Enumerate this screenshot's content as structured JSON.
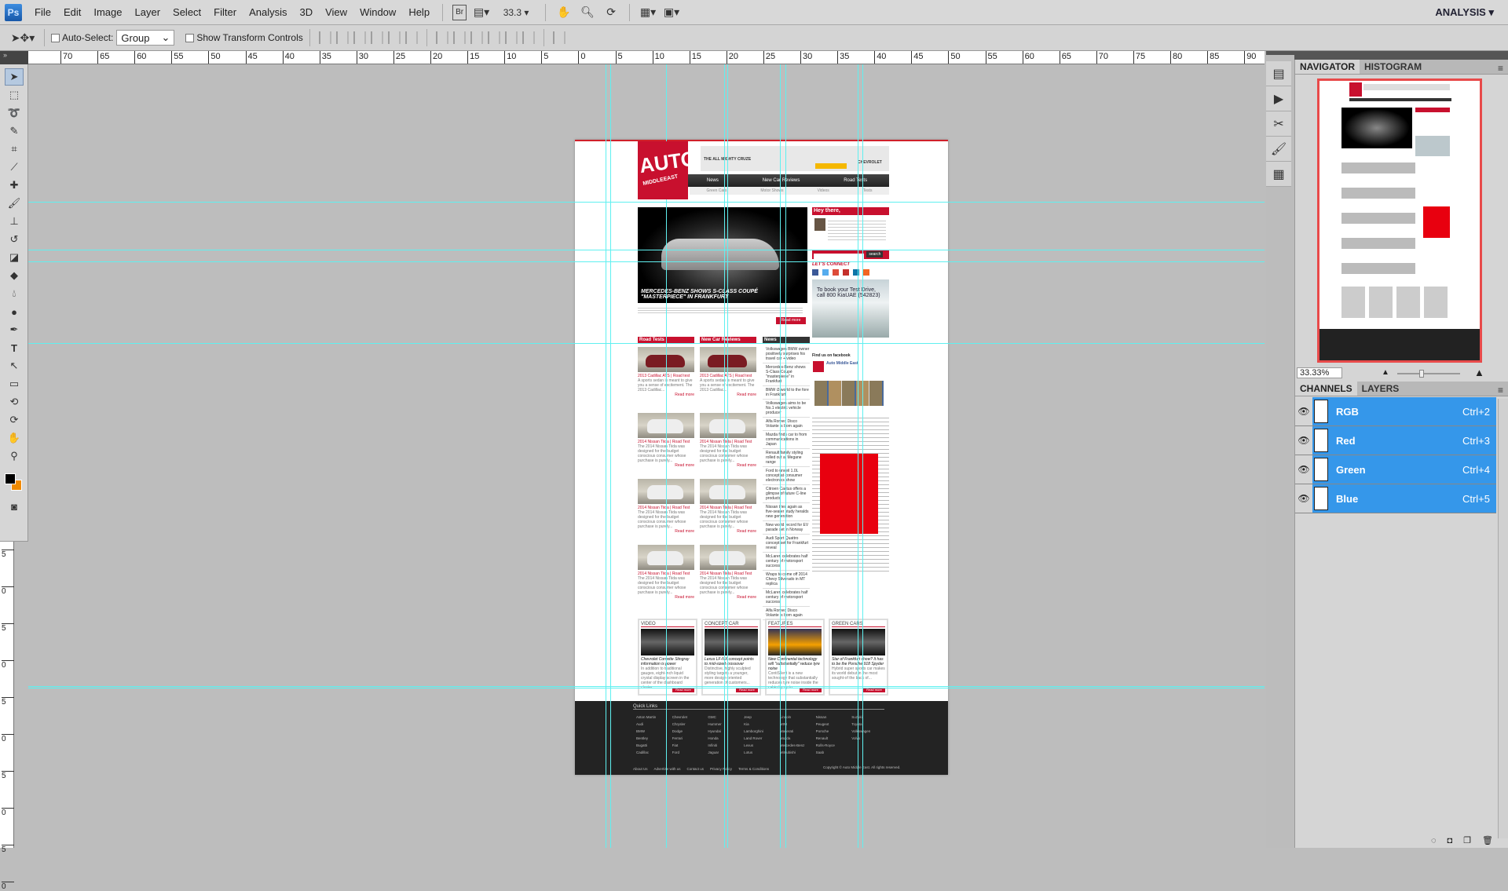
{
  "app": {
    "logo": "Ps",
    "menu": [
      "File",
      "Edit",
      "Image",
      "Layer",
      "Select",
      "Filter",
      "Analysis",
      "3D",
      "View",
      "Window",
      "Help"
    ],
    "zoom_dropdown": "33.3",
    "workspace": "ANALYSIS",
    "toolbar_icons": [
      "bridge-icon",
      "mini-bridge-icon",
      "hand-icon",
      "zoom-icon",
      "rotate-view-icon",
      "arrange-icon",
      "screen-mode-icon"
    ]
  },
  "options": {
    "auto_select_label": "Auto-Select:",
    "auto_select_checked": false,
    "auto_select_value": "Group",
    "show_transform_label": "Show Transform Controls",
    "show_transform_checked": false
  },
  "ruler": {
    "top_labels": [
      "70",
      "65",
      "60",
      "55",
      "50",
      "45",
      "40",
      "35",
      "30",
      "25",
      "20",
      "15",
      "10",
      "5",
      "0",
      "5",
      "10",
      "15",
      "20",
      "25",
      "30",
      "35",
      "40",
      "45",
      "50",
      "55",
      "60",
      "65",
      "70",
      "75",
      "80",
      "85",
      "90"
    ],
    "left_labels": [
      "5",
      "0",
      "5",
      "0",
      "5",
      "0",
      "5",
      "0",
      "5",
      "0"
    ]
  },
  "colors": {
    "guide": "#5ff0f0",
    "brand_red": "#c8102e",
    "channel_selected": "#3597ea",
    "foreground": "#000000",
    "background": "#f08a00"
  },
  "navigator": {
    "tabs": [
      "NAVIGATOR",
      "HISTOGRAM"
    ],
    "zoom_value": "33.33%"
  },
  "channels": {
    "tabs": [
      "CHANNELS",
      "LAYERS"
    ],
    "rows": [
      {
        "name": "RGB",
        "shortcut": "Ctrl+2"
      },
      {
        "name": "Red",
        "shortcut": "Ctrl+3"
      },
      {
        "name": "Green",
        "shortcut": "Ctrl+4"
      },
      {
        "name": "Blue",
        "shortcut": "Ctrl+5"
      }
    ]
  },
  "site": {
    "logo_top": "AUTO",
    "logo_bottom": "MIDDLEEAST",
    "ad_headline": "THE ALL MIGHTY CRUZE",
    "ad_brand": "CHEVROLET",
    "nav": [
      "News",
      "New Car Reviews",
      "Road Tests"
    ],
    "subnav": [
      "Green Cars",
      "Motor Shows",
      "Videos",
      "Tests"
    ],
    "hero_title": "MERCEDES-BENZ SHOWS S-CLASS COUPÉ \"MASTERPIECE\" IN FRANKFURT",
    "hero_button": "Read more",
    "hey_title": "Hey there,",
    "search_button": "search",
    "connect_title": "LET'S CONNECT",
    "kia_ad": "To book your Test Drive, call 800 KiaUAE (542823)",
    "fb_title": "Find us on facebook",
    "fb_page": "Auto Middle East",
    "sections": [
      "Road Tests",
      "New Car Reviews",
      "News"
    ],
    "road_tests": [
      {
        "title": "2013 Cadillac ATS | Road test",
        "text": "A sports sedan is meant to give you a sense of excitement. The 2013 Cadillac..."
      },
      {
        "title": "2014 Nissan Tiida | Road Test",
        "text": "The 2014 Nissan Tiida was designed for the budget conscious consumer whose purchase is purely..."
      },
      {
        "title": "2014 Nissan Tiida | Road Test",
        "text": "The 2014 Nissan Tiida was designed for the budget conscious consumer whose purchase is purely..."
      },
      {
        "title": "2014 Nissan Tiida | Road Test",
        "text": "The 2014 Nissan Tiida was designed for the budget conscious consumer whose purchase is purely..."
      }
    ],
    "reviews": [
      {
        "title": "2013 Cadillac ATS | Road test",
        "text": "A sports sedan is meant to give you a sense of excitement. The 2013 Cadillac..."
      },
      {
        "title": "2014 Nissan Tiida | Road Test",
        "text": "The 2014 Nissan Tiida was designed for the budget conscious consumer whose purchase is purely..."
      },
      {
        "title": "2014 Nissan Tiida | Road Test",
        "text": "The 2014 Nissan Tiida was designed for the budget conscious consumer whose purchase is purely..."
      },
      {
        "title": "2014 Nissan Tiida | Road Test",
        "text": "The 2014 Nissan Tiida was designed for the budget conscious consumer whose purchase is purely..."
      }
    ],
    "read_more": "Read more",
    "news": [
      "Volkswagen BMW owner positively surprises his travel car + video",
      "Mercedes-Benz shows S-Class Coupé \"masterpiece\" in Frankfurt",
      "BMW i3 world to the fore in Frankfurt",
      "Volkswagen aims to be No.1 electric vehicle producer",
      "Alfa Romeo Disco Volante is born again",
      "Mazda finds car to from communications in Japan",
      "Renault family styling rolled out at Megane range",
      "Ford to unveil 1.0L concept at consumer electronics show",
      "Citroen Cactus offers a glimpse of future C-line products",
      "Nissan tries again as five-seater study heralds new generation",
      "New world record for EV parade set in Norway",
      "Audi Sport Quattro concept set for Frankfurt reveal",
      "McLaren celebrates half century of motorsport success",
      "Wraps to come off 2014 Chevy Silverado in MT replica",
      "McLaren celebrates half century of motorsport success",
      "Alfa Romeo Disco Volante is born again"
    ],
    "features": [
      {
        "section": "VIDEO",
        "title": "Chevrolet Corvette Stingray information is power",
        "text": "In addition to traditional gauges, eight-inch liquid crystal display screen in the center of the dashboard cluster..."
      },
      {
        "section": "CONCEPT CAR",
        "title": "Lexus LF-NX concept points to mid-sized crossover",
        "text": "Distinctive, highly sculpted styling targets a younger, more design-oriented generation of customers..."
      },
      {
        "section": "FEATURES",
        "title": "New Continental technology will \"substantially\" reduce tyre noise",
        "text": "ContiSilent is a new technology that substantially reduces tyre noise inside the cabin by up to..."
      },
      {
        "section": "GREEN CARS",
        "title": "Star of Frankfurt show? It has to be the Porsche 918 Spyder",
        "text": "Hybrid super sports car makes its world debut in the most sought-of the back of..."
      }
    ],
    "quick_links_title": "Quick Links",
    "quick_links": [
      "Aston Martin",
      "Audi",
      "BMW",
      "Bentley",
      "Bugatti",
      "Cadillac",
      "Chevrolet",
      "Chrysler",
      "Dodge",
      "Ferrari",
      "Fiat",
      "Ford",
      "GMC",
      "Hummer",
      "Hyundai",
      "Honda",
      "Infiniti",
      "Jaguar",
      "Jeep",
      "Kia",
      "Lamborghini",
      "Land Rover",
      "Lexus",
      "Lotus",
      "Lincoln",
      "MINI",
      "Maserati",
      "Mazda",
      "Mercedes-Benz",
      "Mitsubishi",
      "Nissan",
      "Peugeot",
      "Porsche",
      "Renault",
      "Rolls-Royce",
      "Saab",
      "Suzuki",
      "Toyota",
      "Volkswagen",
      "Volvo"
    ],
    "footer_links": [
      "About Us",
      "Advertise with us",
      "Contact us",
      "Privacy Policy",
      "Terms & Conditions"
    ],
    "copyright": "Copyright © Auto Middle East. All rights reserved."
  }
}
